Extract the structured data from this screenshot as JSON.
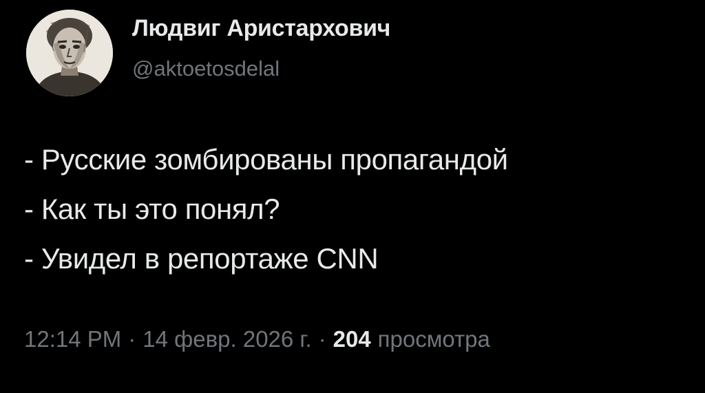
{
  "author": {
    "display_name": "Людвиг Аристархович",
    "handle": "@aktoetosdelal",
    "avatar_icon": "sketch-portrait-avatar"
  },
  "tweet": {
    "lines": [
      "- Русские зомбированы пропагандой",
      "- Как ты это понял?",
      "- Увидел в репортаже CNN"
    ]
  },
  "meta": {
    "time": "12:14 PM",
    "separator": "·",
    "date": "14 февр. 2026 г.",
    "views_count": "204",
    "views_label": "просмотра"
  },
  "colors": {
    "background": "#000000",
    "primary_text": "#e7e9ea",
    "secondary_text": "#71767b"
  }
}
